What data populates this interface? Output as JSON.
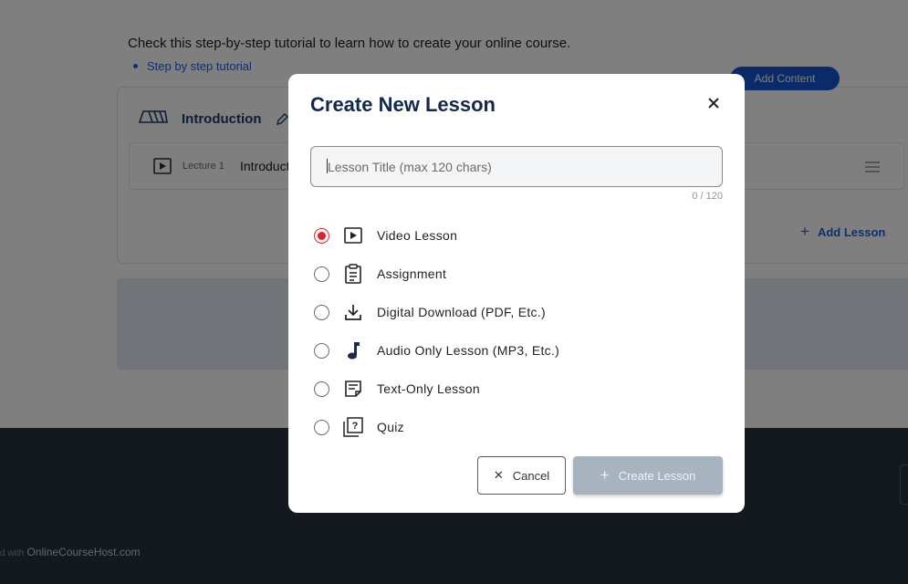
{
  "background": {
    "intro_text": "Check this step-by-step tutorial to learn how to create your online course.",
    "tutorial_link": "Step by step tutorial",
    "section_title": "Introduction",
    "lecture_label": "Lecture 1",
    "lecture_name": "Introducti",
    "add_content_label": "Add Content",
    "add_lesson_label": "Add Lesson",
    "footer_made": "d with",
    "footer_brand": "OnlineCourseHost.com"
  },
  "modal": {
    "title": "Create New Lesson",
    "input_placeholder": "Lesson Title (max 120 chars)",
    "input_value": "",
    "char_count": "0 / 120",
    "options": [
      {
        "label": "Video Lesson",
        "icon": "video-lesson-icon",
        "checked": true
      },
      {
        "label": "Assignment",
        "icon": "assignment-icon",
        "checked": false
      },
      {
        "label": "Digital Download (PDF, Etc.)",
        "icon": "download-icon",
        "checked": false
      },
      {
        "label": "Audio Only Lesson (MP3, Etc.)",
        "icon": "music-note-icon",
        "checked": false
      },
      {
        "label": "Text-Only Lesson",
        "icon": "text-note-icon",
        "checked": false
      },
      {
        "label": "Quiz",
        "icon": "quiz-icon",
        "checked": false
      }
    ],
    "cancel_label": "Cancel",
    "create_label": "Create Lesson"
  },
  "colors": {
    "accent_blue": "#1554d1",
    "radio_selected": "#d8262b",
    "title_navy": "#13294b",
    "create_disabled": "#a7b3bf",
    "footer_bg": "#27323d"
  }
}
